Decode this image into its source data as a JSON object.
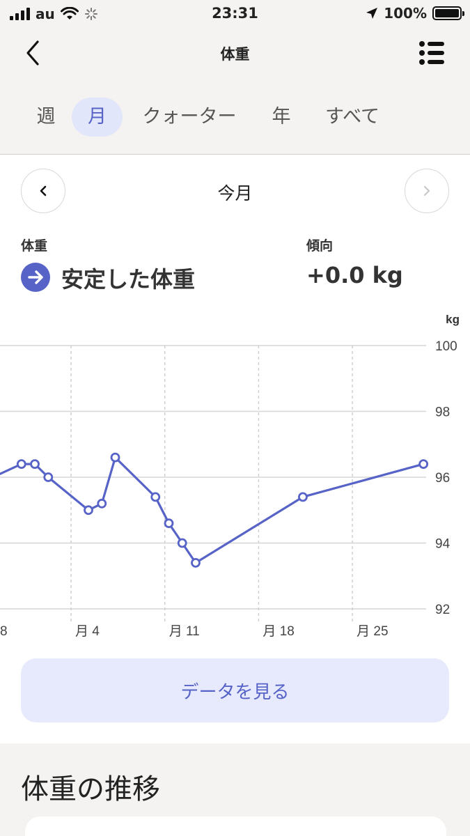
{
  "status_bar": {
    "carrier": "au",
    "time": "23:31",
    "battery": "100%"
  },
  "nav": {
    "title": "体重",
    "back_icon": "chevron-left-icon",
    "menu_icon": "list-icon"
  },
  "tabs": [
    {
      "label": "週",
      "active": false
    },
    {
      "label": "月",
      "active": true
    },
    {
      "label": "クォーター",
      "active": false
    },
    {
      "label": "年",
      "active": false
    },
    {
      "label": "すべて",
      "active": false
    }
  ],
  "period": {
    "label": "今月",
    "prev_icon": "chevron-left-icon",
    "next_icon": "chevron-right-icon"
  },
  "stats": {
    "weight_label": "体重",
    "weight_value": "安定した体重",
    "trend_label": "傾向",
    "trend_value": "+0.0 kg",
    "trend_icon": "arrow-right-icon"
  },
  "chart_data": {
    "type": "line",
    "unit_label": "kg",
    "ylim": [
      92,
      100
    ],
    "yticks": [
      "100",
      "98",
      "96",
      "94",
      "92"
    ],
    "xlim": [
      -1.3,
      30.5
    ],
    "xticks": [
      {
        "label": "8",
        "day": -1.5
      },
      {
        "label": "月 4",
        "day": 4
      },
      {
        "label": "月 11",
        "day": 11
      },
      {
        "label": "月 18",
        "day": 18
      },
      {
        "label": "月 25",
        "day": 25
      }
    ],
    "grid": true,
    "accent_color": "#5763c7",
    "series": [
      {
        "x": [
          -1.3,
          0.3,
          1.3,
          2.3,
          5.3,
          6.3,
          7.3,
          10.3,
          11.3,
          12.3,
          13.3,
          21.3,
          30.3
        ],
        "y": [
          96.1,
          96.4,
          96.4,
          96.0,
          95.0,
          95.2,
          96.6,
          95.4,
          94.6,
          94.0,
          93.4,
          95.4,
          96.4
        ],
        "markers": [
          false,
          true,
          true,
          true,
          true,
          true,
          true,
          true,
          true,
          true,
          true,
          true,
          true
        ]
      }
    ]
  },
  "buttons": {
    "view_data": "データを見る"
  },
  "section": {
    "title": "体重の推移"
  }
}
